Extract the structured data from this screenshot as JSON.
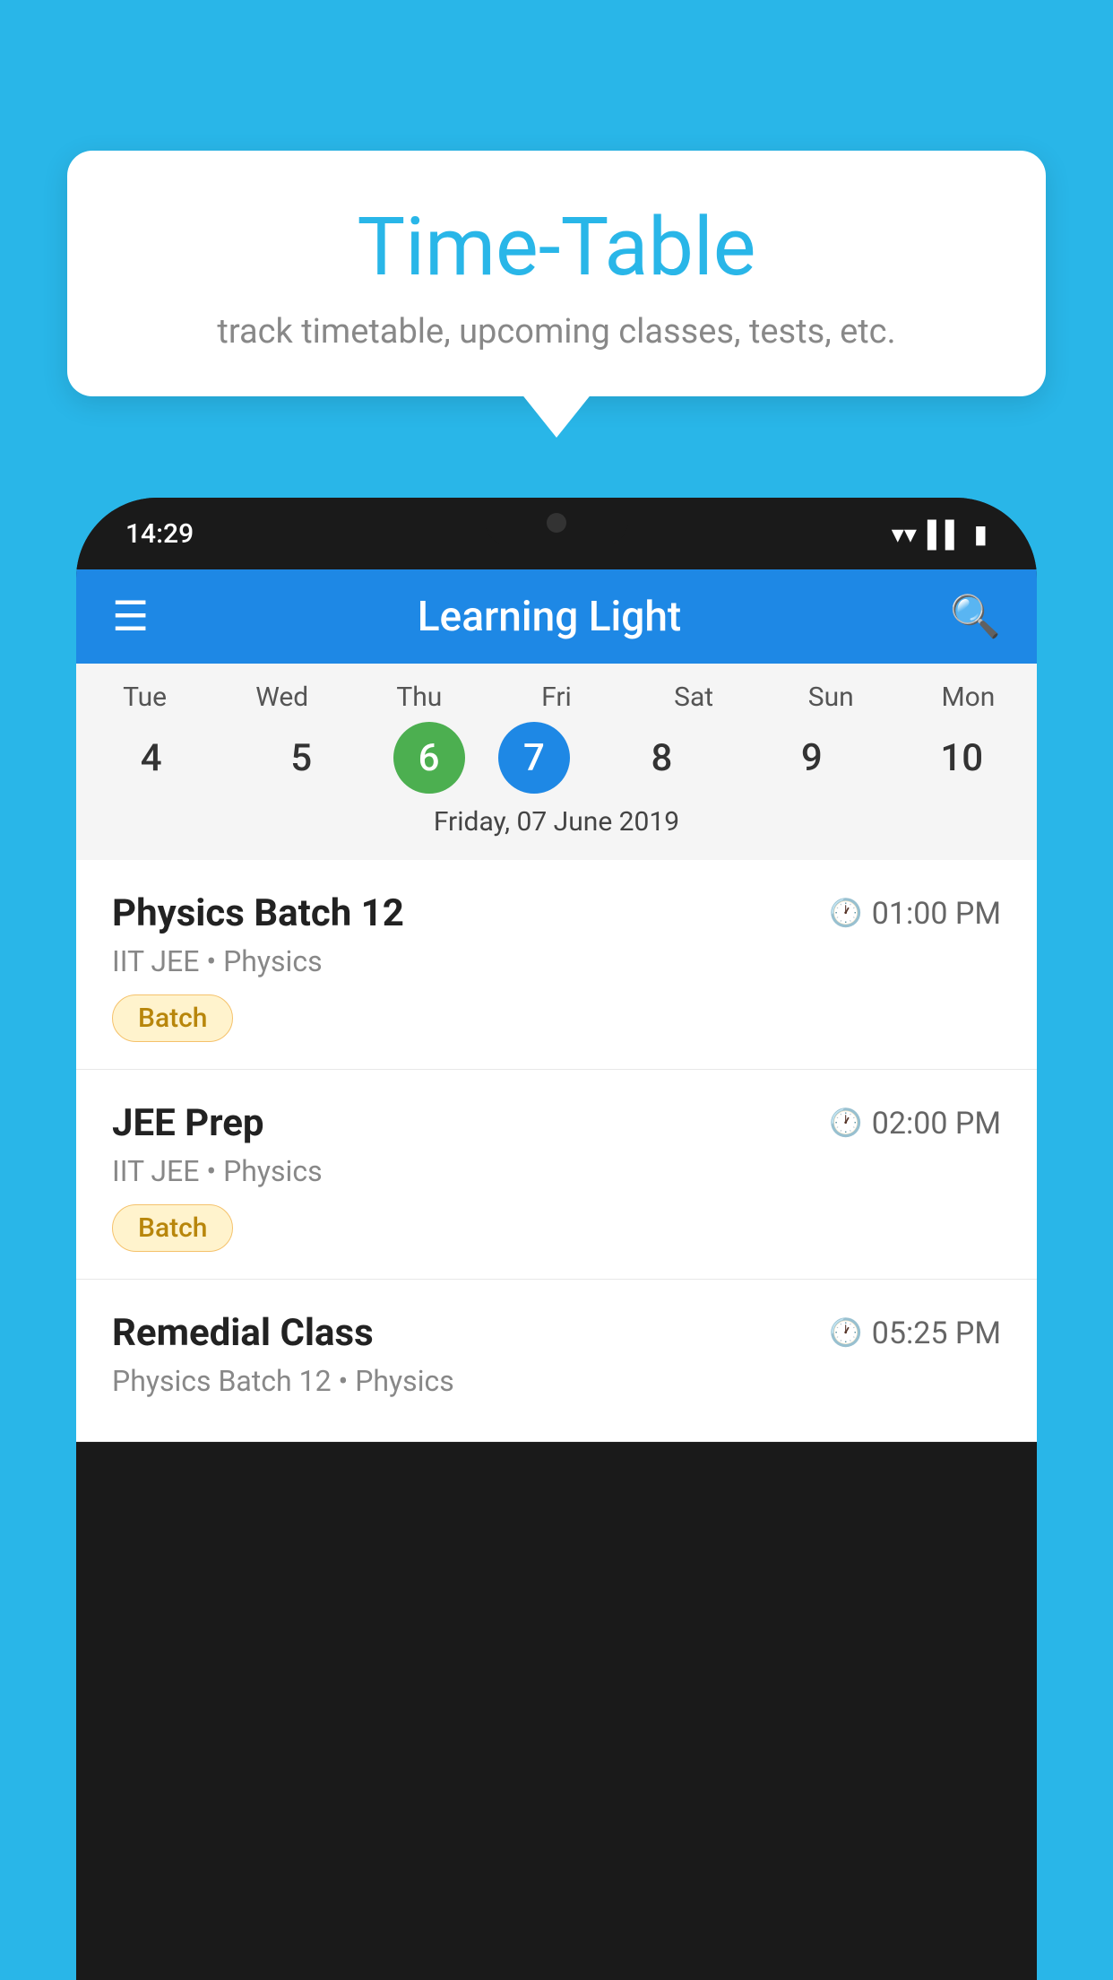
{
  "background_color": "#29B6E8",
  "tooltip": {
    "title": "Time-Table",
    "subtitle": "track timetable, upcoming classes, tests, etc."
  },
  "phone": {
    "status_bar": {
      "time": "14:29"
    },
    "app_bar": {
      "title": "Learning Light",
      "menu_icon": "☰",
      "search_icon": "🔍"
    },
    "calendar": {
      "days": [
        {
          "label": "Tue",
          "num": "4",
          "style": "normal"
        },
        {
          "label": "Wed",
          "num": "5",
          "style": "normal"
        },
        {
          "label": "Thu",
          "num": "6",
          "style": "green"
        },
        {
          "label": "Fri",
          "num": "7",
          "style": "blue"
        },
        {
          "label": "Sat",
          "num": "8",
          "style": "normal"
        },
        {
          "label": "Sun",
          "num": "9",
          "style": "normal"
        },
        {
          "label": "Mon",
          "num": "10",
          "style": "normal"
        }
      ],
      "selected_date": "Friday, 07 June 2019"
    },
    "classes": [
      {
        "name": "Physics Batch 12",
        "time": "01:00 PM",
        "subtitle": "IIT JEE • Physics",
        "badge": "Batch"
      },
      {
        "name": "JEE Prep",
        "time": "02:00 PM",
        "subtitle": "IIT JEE • Physics",
        "badge": "Batch"
      },
      {
        "name": "Remedial Class",
        "time": "05:25 PM",
        "subtitle": "Physics Batch 12 • Physics",
        "badge": null
      }
    ]
  }
}
